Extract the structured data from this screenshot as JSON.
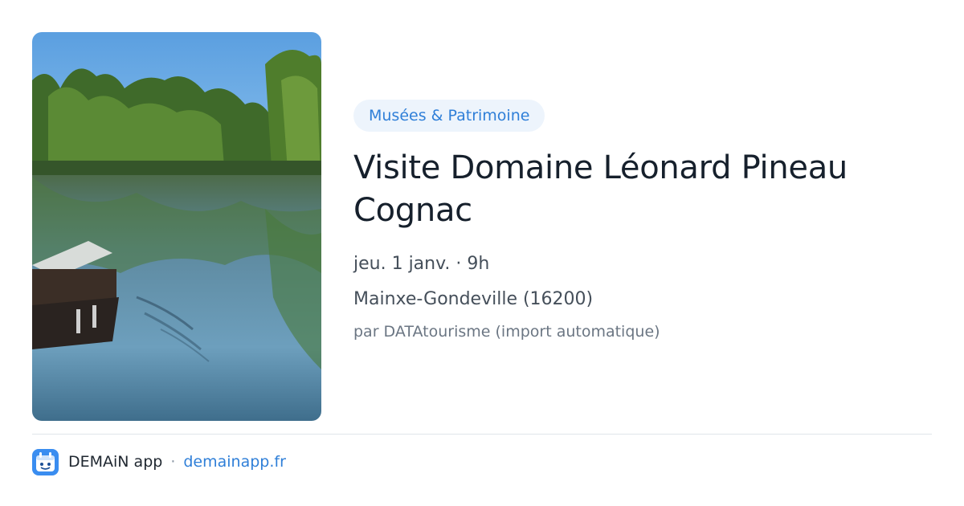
{
  "event": {
    "category": "Musées & Patrimoine",
    "title": "Visite Domaine Léonard Pineau Cognac",
    "date": "jeu. 1 janv. · 9h",
    "location": "Mainxe-Gondeville (16200)",
    "author": "par DATAtourisme (import automatique)",
    "image_icon": "river-landscape-photo"
  },
  "footer": {
    "app_name": "DEMAiN app",
    "separator": "·",
    "url": "demainapp.fr",
    "icon": "calendar-app-icon"
  },
  "colors": {
    "accent": "#2f7fd8",
    "tag_bg": "#edf4fc",
    "title": "#16202c",
    "muted": "#6b7683"
  }
}
